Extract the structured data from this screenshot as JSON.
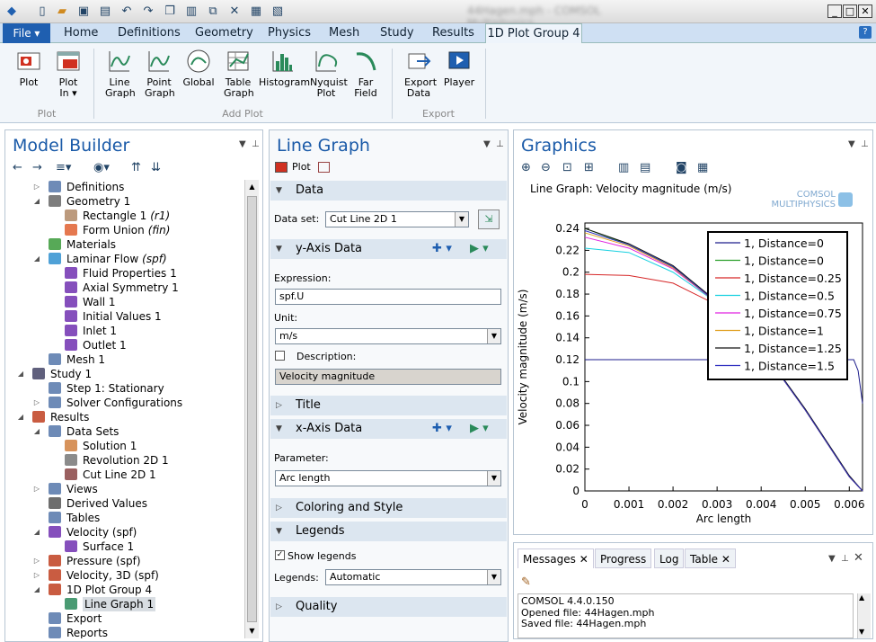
{
  "window": {
    "title": "44Hagen.mph - COMSOL Multiphysics"
  },
  "menu": {
    "file": "File ▾",
    "tabs": [
      "Home",
      "Definitions",
      "Geometry",
      "Physics",
      "Mesh",
      "Study",
      "Results"
    ],
    "active_tab": "1D Plot Group 4",
    "help": "?"
  },
  "ribbon": {
    "plot": {
      "label": "Plot",
      "plot_in": "Plot In ▾",
      "group": "Plot"
    },
    "add_plot": {
      "group": "Add Plot",
      "items": [
        "Line Graph",
        "Point Graph",
        "Global",
        "Table Graph",
        "Histogram",
        "Nyquist Plot",
        "Far Field"
      ]
    },
    "export": {
      "group": "Export",
      "items": [
        "Export Data",
        "Player"
      ]
    }
  },
  "model_builder": {
    "title": "Model Builder",
    "tree": [
      {
        "label": "Definitions",
        "level": 3,
        "arrow": "▷"
      },
      {
        "label": "Geometry 1",
        "level": 3,
        "arrow": "◢"
      },
      {
        "label": "Rectangle 1",
        "tag": "(r1)",
        "level": 4,
        "arrow": ""
      },
      {
        "label": "Form Union",
        "tag": "(fin)",
        "level": 4,
        "arrow": ""
      },
      {
        "label": "Materials",
        "level": 3,
        "arrow": ""
      },
      {
        "label": "Laminar Flow",
        "tag": "(spf)",
        "level": 3,
        "arrow": "◢"
      },
      {
        "label": "Fluid Properties 1",
        "level": 4,
        "arrow": ""
      },
      {
        "label": "Axial Symmetry 1",
        "level": 4,
        "arrow": ""
      },
      {
        "label": "Wall 1",
        "level": 4,
        "arrow": ""
      },
      {
        "label": "Initial Values 1",
        "level": 4,
        "arrow": ""
      },
      {
        "label": "Inlet 1",
        "level": 4,
        "arrow": ""
      },
      {
        "label": "Outlet 1",
        "level": 4,
        "arrow": ""
      },
      {
        "label": "Mesh 1",
        "level": 3,
        "arrow": ""
      },
      {
        "label": "Study 1",
        "level": 2,
        "arrow": "◢"
      },
      {
        "label": "Step 1: Stationary",
        "level": 3,
        "arrow": ""
      },
      {
        "label": "Solver Configurations",
        "level": 3,
        "arrow": "▷"
      },
      {
        "label": "Results",
        "level": 2,
        "arrow": "◢"
      },
      {
        "label": "Data Sets",
        "level": 3,
        "arrow": "◢"
      },
      {
        "label": "Solution 1",
        "level": 4,
        "arrow": ""
      },
      {
        "label": "Revolution 2D 1",
        "level": 4,
        "arrow": ""
      },
      {
        "label": "Cut Line 2D 1",
        "level": 4,
        "arrow": ""
      },
      {
        "label": "Views",
        "level": 3,
        "arrow": "▷"
      },
      {
        "label": "Derived Values",
        "level": 3,
        "arrow": ""
      },
      {
        "label": "Tables",
        "level": 3,
        "arrow": ""
      },
      {
        "label": "Velocity (spf)",
        "level": 3,
        "arrow": "◢"
      },
      {
        "label": "Surface 1",
        "level": 4,
        "arrow": ""
      },
      {
        "label": "Pressure (spf)",
        "level": 3,
        "arrow": "▷"
      },
      {
        "label": "Velocity, 3D (spf)",
        "level": 3,
        "arrow": "▷"
      },
      {
        "label": "1D Plot Group 4",
        "level": 3,
        "arrow": "◢"
      },
      {
        "label": "Line Graph 1",
        "level": 4,
        "arrow": "",
        "selected": true
      },
      {
        "label": "Export",
        "level": 3,
        "arrow": ""
      },
      {
        "label": "Reports",
        "level": 3,
        "arrow": ""
      }
    ]
  },
  "settings": {
    "title": "Line Graph",
    "plot_label": "Plot",
    "data": {
      "title": "Data",
      "dataset_label": "Data set:",
      "dataset_value": "Cut Line 2D 1"
    },
    "yaxis": {
      "title": "y-Axis Data",
      "expression_label": "Expression:",
      "expression_value": "spf.U",
      "unit_label": "Unit:",
      "unit_value": "m/s",
      "description_label": "Description:",
      "description_value": "Velocity magnitude"
    },
    "title_section": "Title",
    "xaxis": {
      "title": "x-Axis Data",
      "parameter_label": "Parameter:",
      "parameter_value": "Arc length"
    },
    "coloring": "Coloring and Style",
    "legends": {
      "title": "Legends",
      "show_label": "Show legends",
      "legends_label": "Legends:",
      "legends_value": "Automatic"
    },
    "quality": "Quality"
  },
  "graphics": {
    "title": "Graphics",
    "plot_title": "Line Graph: Velocity magnitude (m/s)",
    "logo_line1": "COMSOL",
    "logo_line2": "MULTIPHYSICS"
  },
  "chart_data": {
    "type": "line",
    "title": "Line Graph: Velocity magnitude (m/s)",
    "xlabel": "Arc length",
    "ylabel": "Velocity magnitude (m/s)",
    "xlim": [
      0,
      0.0063
    ],
    "ylim": [
      0,
      0.245
    ],
    "xticks": [
      "0",
      "0.001",
      "0.002",
      "0.003",
      "0.004",
      "0.005",
      "0.006"
    ],
    "yticks": [
      "0",
      "0.02",
      "0.04",
      "0.06",
      "0.08",
      "0.1",
      "0.12",
      "0.14",
      "0.16",
      "0.18",
      "0.2",
      "0.22",
      "0.24"
    ],
    "legend_position": "top-right",
    "series": [
      {
        "name": "1, Distance=0",
        "color": "#1e1e8c",
        "x": [
          0,
          0.0061,
          0.0062,
          0.0063
        ],
        "y": [
          0.12,
          0.12,
          0.11,
          0.08
        ]
      },
      {
        "name": "1, Distance=0",
        "color": "#2ca02c",
        "x": [
          0,
          0.001,
          0.002,
          0.003,
          0.004,
          0.005,
          0.006,
          0.0063
        ],
        "y": [
          0.24,
          0.225,
          0.205,
          0.172,
          0.13,
          0.074,
          0.013,
          0
        ]
      },
      {
        "name": "1, Distance=0.25",
        "color": "#d62728",
        "x": [
          0,
          0.001,
          0.002,
          0.003,
          0.004,
          0.005,
          0.006,
          0.0063
        ],
        "y": [
          0.198,
          0.197,
          0.19,
          0.17,
          0.13,
          0.074,
          0.013,
          0
        ]
      },
      {
        "name": "1, Distance=0.5",
        "color": "#17d0e0",
        "x": [
          0,
          0.001,
          0.002,
          0.003,
          0.004,
          0.005,
          0.006,
          0.0063
        ],
        "y": [
          0.222,
          0.218,
          0.2,
          0.172,
          0.13,
          0.074,
          0.013,
          0
        ]
      },
      {
        "name": "1, Distance=0.75",
        "color": "#e020e0",
        "x": [
          0,
          0.001,
          0.002,
          0.003,
          0.004,
          0.005,
          0.006,
          0.0063
        ],
        "y": [
          0.232,
          0.222,
          0.203,
          0.172,
          0.13,
          0.074,
          0.013,
          0
        ]
      },
      {
        "name": "1, Distance=1",
        "color": "#e0a020",
        "x": [
          0,
          0.001,
          0.002,
          0.003,
          0.004,
          0.005,
          0.006,
          0.0063
        ],
        "y": [
          0.236,
          0.224,
          0.204,
          0.172,
          0.13,
          0.074,
          0.013,
          0
        ]
      },
      {
        "name": "1, Distance=1.25",
        "color": "#111111",
        "x": [
          0,
          0.001,
          0.002,
          0.003,
          0.004,
          0.005,
          0.006,
          0.0063
        ],
        "y": [
          0.24,
          0.226,
          0.206,
          0.173,
          0.131,
          0.075,
          0.014,
          0
        ]
      },
      {
        "name": "1, Distance=1.5",
        "color": "#3030c0",
        "x": [
          0,
          0.001,
          0.002,
          0.003,
          0.004,
          0.005,
          0.006,
          0.0063
        ],
        "y": [
          0.238,
          0.225,
          0.205,
          0.172,
          0.13,
          0.074,
          0.013,
          0
        ]
      }
    ]
  },
  "messages": {
    "tabs": [
      "Messages",
      "Progress",
      "Log",
      "Table"
    ],
    "lines": [
      "COMSOL 4.4.0.150",
      "Opened file: 44Hagen.mph",
      "Saved file: 44Hagen.mph"
    ]
  }
}
